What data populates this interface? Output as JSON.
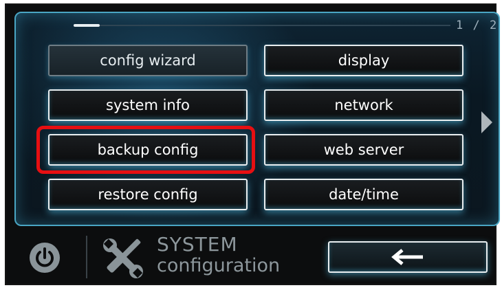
{
  "header": {
    "page_indicator": "1 / 2",
    "progress": 0.07
  },
  "menu": {
    "config_wizard": "config wizard",
    "display": "display",
    "system_info": "system info",
    "network": "network",
    "backup_config": "backup config",
    "web_server": "web server",
    "restore_config": "restore config",
    "date_time": "date/time"
  },
  "footer": {
    "title_line1": "SYSTEM",
    "title_line2": "configuration",
    "icons": {
      "power": "power-icon",
      "tools": "tools-icon",
      "back": "arrow-left-icon",
      "next_page": "arrow-right-icon"
    }
  },
  "colors": {
    "highlight": "#e60f12",
    "glow": "#4aa6c4"
  }
}
